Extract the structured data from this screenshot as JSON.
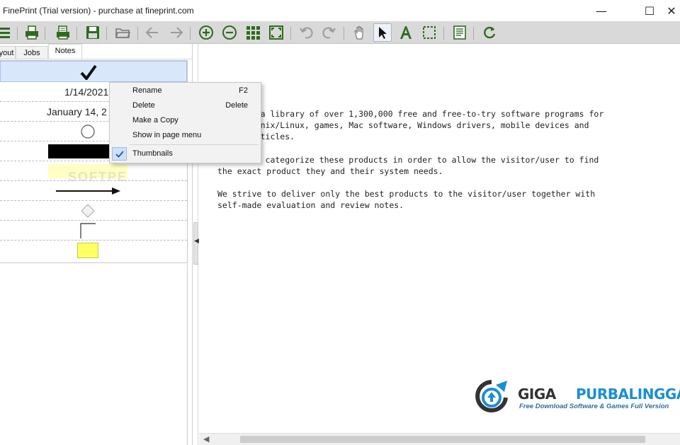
{
  "window": {
    "title": "FinePrint (Trial version) - purchase at fineprint.com",
    "minimize": "—",
    "maximize": "☐",
    "close": "✕"
  },
  "toolbar": {
    "icons": [
      "menu-icon",
      "print-icon",
      "print-settings-icon",
      "save-icon",
      "open-folder-icon",
      "back-arrow-icon",
      "forward-arrow-icon",
      "zoom-in-icon",
      "zoom-out-icon",
      "thumbnail-grid-icon",
      "fit-page-icon",
      "undo-icon",
      "redo-icon",
      "hand-tool-icon",
      "pointer-tool-icon",
      "text-tool-icon",
      "selection-tool-icon",
      "notes-icon",
      "refresh-icon"
    ],
    "accent": "#2e6b1f"
  },
  "left_panel": {
    "tabs": [
      "yout",
      "Jobs",
      "Notes"
    ],
    "selected_tab": "Notes",
    "rows": [
      {
        "kind": "checkmark-icon",
        "text": ""
      },
      {
        "kind": "date",
        "text": "1/14/2021"
      },
      {
        "kind": "date",
        "text": "January 14, 2"
      },
      {
        "kind": "circle-shape-icon",
        "text": ""
      },
      {
        "kind": "black-rectangle-icon",
        "text": ""
      },
      {
        "kind": "yellow-highlight-icon",
        "text": ""
      },
      {
        "kind": "arrow-line-icon",
        "text": ""
      },
      {
        "kind": "diamond-shape-icon",
        "text": ""
      },
      {
        "kind": "corner-bracket-icon",
        "text": ""
      },
      {
        "kind": "sticky-note-icon",
        "text": ""
      }
    ]
  },
  "context_menu": {
    "items": [
      {
        "label": "Rename",
        "shortcut": "F2"
      },
      {
        "label": "Delete",
        "shortcut": "Delete"
      },
      {
        "label": "Make a Copy",
        "shortcut": ""
      },
      {
        "label": "Show in page menu",
        "shortcut": ""
      },
      {
        "label": "Thumbnails",
        "shortcut": "",
        "checked": true
      }
    ]
  },
  "preview": {
    "lines": [
      "a is a library of over 1,300,000 free and free-to-try software programs for",
      "and Unix/Linux, games, Mac software, Windows drivers, mobile devices and",
      "ed articles.",
      "w and categorize these products in order to allow the visitor/user to find",
      "the exact product they and their system needs.",
      "We strive to deliver only the best products to the visitor/user together with",
      "self-made evaluation and review notes."
    ]
  },
  "watermark": {
    "brand_part1": "GIGA",
    "brand_part2": "PURBALINGGA",
    "tagline": "Free Download Software & Games Full Version",
    "overlay": "SOFTPE"
  }
}
